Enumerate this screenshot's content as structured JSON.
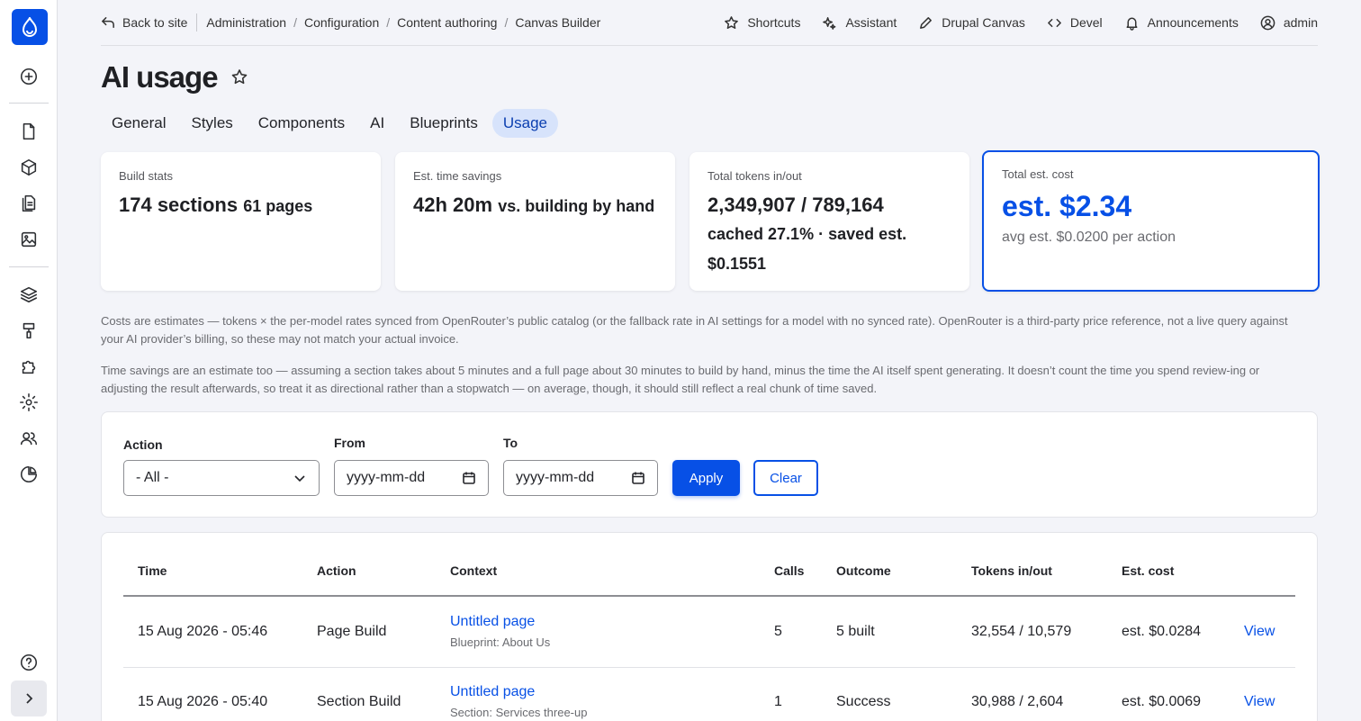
{
  "sidebar": {
    "items": [
      "drupal-logo",
      "add-icon",
      "content-icon",
      "components-icon",
      "pages-icon",
      "media-icon",
      "structure-icon",
      "appearance-icon",
      "extend-icon",
      "configuration-icon",
      "people-icon",
      "reports-icon",
      "help-icon",
      "expand-icon"
    ]
  },
  "topbar": {
    "back_label": "Back to site",
    "breadcrumb": [
      "Administration",
      "Configuration",
      "Content authoring",
      "Canvas Builder"
    ],
    "tools": [
      "Shortcuts",
      "Assistant",
      "Drupal Canvas",
      "Devel",
      "Announcements",
      "admin"
    ]
  },
  "page": {
    "title": "AI usage"
  },
  "tabs": [
    "General",
    "Styles",
    "Components",
    "AI",
    "Blueprints",
    "Usage"
  ],
  "active_tab": "Usage",
  "stats": {
    "build": {
      "label": "Build stats",
      "sections": "174 sections",
      "pages": "61 pages"
    },
    "time": {
      "label": "Est. time savings",
      "value": "42h 20m",
      "suffix": "vs. building by hand"
    },
    "tokens": {
      "label": "Total tokens in/out",
      "value": "2,349,907 / 789,164",
      "cached": "cached 27.1% · saved est. $0.1551"
    },
    "cost": {
      "label": "Total est. cost",
      "value": "est. $2.34",
      "avg": "avg est. $0.0200 per action"
    }
  },
  "notes": {
    "costs": "Costs are estimates — tokens × the per-model rates synced from OpenRouter’s public catalog (or the fallback rate in AI settings for a model with no synced rate). OpenRouter is a third-party price reference, not a live query against your AI provider’s billing, so these may not match your actual invoice.",
    "time": "Time savings are an estimate too — assuming a section takes about 5 minutes and a full page about 30 minutes to build by hand, minus the time the AI itself spent generating. It doesn’t count the time you spend review-ing or adjusting the result afterwards, so treat it as directional rather than a stopwatch — on average, though, it should still reflect a real chunk of time saved."
  },
  "filter": {
    "action_label": "Action",
    "action_value": "- All -",
    "from_label": "From",
    "from_placeholder": "yyyy-mm-dd",
    "to_label": "To",
    "to_placeholder": "yyyy-mm-dd",
    "apply": "Apply",
    "clear": "Clear"
  },
  "table": {
    "headers": [
      "Time",
      "Action",
      "Context",
      "Calls",
      "Outcome",
      "Tokens in/out",
      "Est. cost"
    ],
    "rows": [
      {
        "time": "15 Aug 2026 - 05:46",
        "action": "Page Build",
        "context": "Untitled page",
        "context_sub": "Blueprint: About Us",
        "calls": "5",
        "outcome": "5 built",
        "tokens": "32,554 / 10,579",
        "cost": "est. $0.0284",
        "link": "View"
      },
      {
        "time": "15 Aug 2026 - 05:40",
        "action": "Section Build",
        "context": "Untitled page",
        "context_sub": "Section: Services three-up",
        "calls": "1",
        "outcome": "Success",
        "tokens": "30,988 / 2,604",
        "cost": "est. $0.0069",
        "link": "View"
      }
    ]
  }
}
